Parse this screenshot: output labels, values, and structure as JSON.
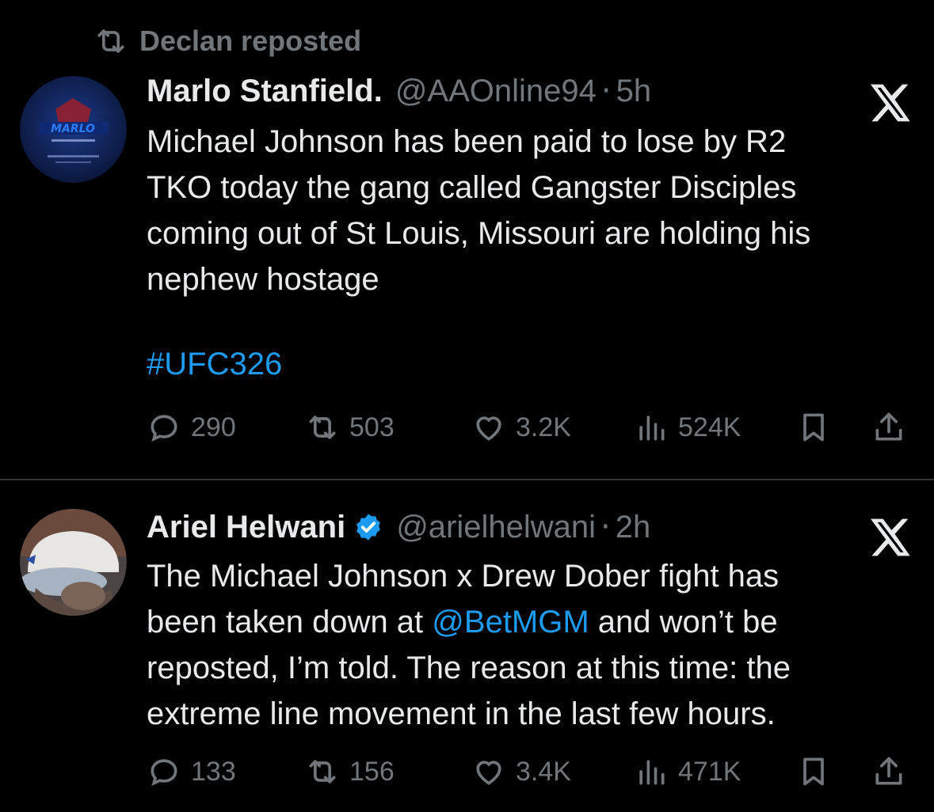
{
  "repost_banner": {
    "text": "Declan reposted"
  },
  "tweets": [
    {
      "name": "Marlo Stanfield.",
      "handle": "@AAOnline94",
      "separator": "·",
      "time": "5h",
      "verified": false,
      "body_lines": [
        "Michael Johnson has been paid to lose by R2",
        "TKO today the gang called Gangster Disciples",
        "coming out of St Louis, Missouri are holding his",
        "nephew hostage"
      ],
      "hashtag": "#UFC326",
      "stats": {
        "replies": "290",
        "reposts": "503",
        "likes": "3.2K",
        "views": "524K"
      }
    },
    {
      "name": "Ariel Helwani",
      "handle": "@arielhelwani",
      "separator": "·",
      "time": "2h",
      "verified": true,
      "body_line1": "The Michael Johnson x Drew Dober fight has",
      "body_line2_pre": "been taken down at ",
      "body_mention": "@BetMGM",
      "body_line2_post": " and won’t be",
      "body_line3": "reposted, I’m told. The reason at this time: the",
      "body_line4": "extreme line movement in the last few hours.",
      "stats": {
        "replies": "133",
        "reposts": "156",
        "likes": "3.4K",
        "views": "471K"
      }
    }
  ],
  "colors": {
    "background": "#000000",
    "text": "#e7e9ea",
    "muted": "#71767b",
    "link": "#1d9bf0",
    "divider": "#2f3336"
  },
  "icons": [
    "repost-icon",
    "reply-icon",
    "like-icon",
    "views-icon",
    "bookmark-icon",
    "share-icon",
    "x-logo-icon",
    "verified-badge-icon"
  ]
}
